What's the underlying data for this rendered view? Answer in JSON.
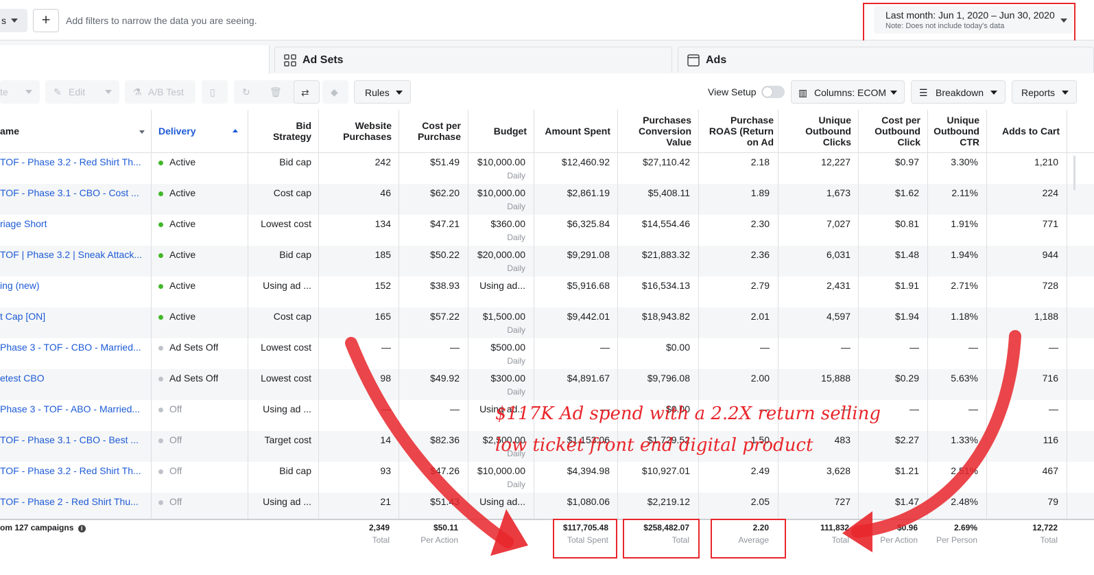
{
  "topbar": {
    "seg_label": "s",
    "plus": "+",
    "filter_placeholder": "Add filters to narrow the data you are seeing.",
    "date_range": "Last month: Jun 1, 2020 – Jun 30, 2020",
    "date_note": "Note: Does not include today's data"
  },
  "tabs": [
    {
      "label": "Ad Sets",
      "icon": "ad-sets-grid-icon"
    },
    {
      "label": "Ads",
      "icon": "ads-window-icon"
    }
  ],
  "toolbar": {
    "duplicate_fragment": "te",
    "edit": "Edit",
    "ab_test": "A/B Test",
    "rules": "Rules",
    "view_setup": "View Setup",
    "columns": "Columns: ECOM",
    "breakdown": "Breakdown",
    "reports": "Reports"
  },
  "columns": {
    "name": "ame",
    "delivery": "Delivery",
    "bid_strategy": "Bid Strategy",
    "website_purchases": "Website Purchases",
    "cost_per_purchase": "Cost per Purchase",
    "budget": "Budget",
    "amount_spent": "Amount Spent",
    "conv_value": "Purchases Conversion Value",
    "roas": "Purchase ROAS (Return on Ad",
    "unique_clicks": "Unique Outbound Clicks",
    "cost_per_click": "Cost per Outbound Click",
    "unique_ctr": "Unique Outbound CTR",
    "adds_to_cart": "Adds to Cart"
  },
  "rows": [
    {
      "name": "TOF - Phase 3.2 - Red Shirt Th...",
      "delivery": "Active",
      "status": "active",
      "bid": "Bid cap",
      "wp": "242",
      "cpp": "$51.49",
      "budget": "$10,000.00",
      "budget_sub": "Daily",
      "spent": "$12,460.92",
      "value": "$27,110.42",
      "roas": "2.18",
      "clicks": "12,227",
      "cpc": "$0.97",
      "ctr": "3.30%",
      "atc": "1,210"
    },
    {
      "name": "TOF - Phase 3.1 - CBO - Cost ...",
      "delivery": "Active",
      "status": "active",
      "bid": "Cost cap",
      "wp": "46",
      "cpp": "$62.20",
      "budget": "$10,000.00",
      "budget_sub": "Daily",
      "spent": "$2,861.19",
      "value": "$5,408.11",
      "roas": "1.89",
      "clicks": "1,673",
      "cpc": "$1.62",
      "ctr": "2.11%",
      "atc": "224"
    },
    {
      "name": "riage Short",
      "delivery": "Active",
      "status": "active",
      "bid": "Lowest cost",
      "wp": "134",
      "cpp": "$47.21",
      "budget": "$360.00",
      "budget_sub": "Daily",
      "spent": "$6,325.84",
      "value": "$14,554.46",
      "roas": "2.30",
      "clicks": "7,027",
      "cpc": "$0.81",
      "ctr": "1.91%",
      "atc": "771"
    },
    {
      "name": "TOF | Phase 3.2 | Sneak Attack...",
      "delivery": "Active",
      "status": "active",
      "bid": "Bid cap",
      "wp": "185",
      "cpp": "$50.22",
      "budget": "$20,000.00",
      "budget_sub": "Daily",
      "spent": "$9,291.08",
      "value": "$21,883.32",
      "roas": "2.36",
      "clicks": "6,031",
      "cpc": "$1.48",
      "ctr": "1.94%",
      "atc": "944"
    },
    {
      "name": "ing (new)",
      "delivery": "Active",
      "status": "active",
      "bid": "Using ad ...",
      "wp": "152",
      "cpp": "$38.93",
      "budget": "Using ad...",
      "budget_sub": "",
      "spent": "$5,916.68",
      "value": "$16,534.13",
      "roas": "2.79",
      "clicks": "2,431",
      "cpc": "$1.91",
      "ctr": "2.71%",
      "atc": "728"
    },
    {
      "name": "t Cap [ON]",
      "delivery": "Active",
      "status": "active",
      "bid": "Cost cap",
      "wp": "165",
      "cpp": "$57.22",
      "budget": "$1,500.00",
      "budget_sub": "Daily",
      "spent": "$9,442.01",
      "value": "$18,943.82",
      "roas": "2.01",
      "clicks": "4,597",
      "cpc": "$1.94",
      "ctr": "1.18%",
      "atc": "1,188"
    },
    {
      "name": "Phase 3 - TOF - CBO - Married...",
      "delivery": "Ad Sets Off",
      "status": "adsetsoff",
      "bid": "Lowest cost",
      "wp": "—",
      "cpp": "—",
      "budget": "$500.00",
      "budget_sub": "Daily",
      "spent": "—",
      "value": "$0.00",
      "roas": "—",
      "clicks": "—",
      "cpc": "—",
      "ctr": "—",
      "atc": "—"
    },
    {
      "name": "etest CBO",
      "delivery": "Ad Sets Off",
      "status": "adsetsoff",
      "bid": "Lowest cost",
      "wp": "98",
      "cpp": "$49.92",
      "budget": "$300.00",
      "budget_sub": "Daily",
      "spent": "$4,891.67",
      "value": "$9,796.08",
      "roas": "2.00",
      "clicks": "15,888",
      "cpc": "$0.29",
      "ctr": "5.63%",
      "atc": "716"
    },
    {
      "name": "Phase 3 - TOF - ABO - Married...",
      "delivery": "Off",
      "status": "off",
      "bid": "Using ad ...",
      "wp": "—",
      "cpp": "—",
      "budget": "Using ad...",
      "budget_sub": "",
      "spent": "—",
      "value": "$0.00",
      "roas": "—",
      "clicks": "—",
      "cpc": "—",
      "ctr": "—",
      "atc": "—"
    },
    {
      "name": "TOF - Phase 3.1 - CBO - Best ...",
      "delivery": "Off",
      "status": "off",
      "bid": "Target cost",
      "wp": "14",
      "cpp": "$82.36",
      "budget": "$2,500.00",
      "budget_sub": "Daily",
      "spent": "$1,153.06",
      "value": "$1,729.52",
      "roas": "1.50",
      "clicks": "483",
      "cpc": "$2.27",
      "ctr": "1.33%",
      "atc": "116"
    },
    {
      "name": "TOF - Phase 3.2 - Red Shirt Th...",
      "delivery": "Off",
      "status": "off",
      "bid": "Bid cap",
      "wp": "93",
      "cpp": "$47.26",
      "budget": "$10,000.00",
      "budget_sub": "Daily",
      "spent": "$4,394.98",
      "value": "$10,927.01",
      "roas": "2.49",
      "clicks": "3,628",
      "cpc": "$1.21",
      "ctr": "2.51%",
      "atc": "467"
    },
    {
      "name": "TOF - Phase 2 - Red Shirt Thu...",
      "delivery": "Off",
      "status": "off",
      "bid": "Using ad ...",
      "wp": "21",
      "cpp": "$51.43",
      "budget": "Using ad...",
      "budget_sub": "",
      "spent": "$1,080.06",
      "value": "$2,219.12",
      "roas": "2.05",
      "clicks": "727",
      "cpc": "$1.47",
      "ctr": "2.48%",
      "atc": "79"
    }
  ],
  "footer": {
    "label": "om 127 campaigns",
    "wp": "2,349",
    "wp_sub": "Total",
    "cpp": "$50.11",
    "cpp_sub": "Per Action",
    "spent": "$117,705.48",
    "spent_sub": "Total Spent",
    "value": "$258,482.07",
    "value_sub": "Total",
    "roas": "2.20",
    "roas_sub": "Average",
    "clicks": "111,832",
    "clicks_sub": "Total",
    "cpc": "$0.96",
    "cpc_sub": "Per Action",
    "ctr": "2.69%",
    "ctr_sub": "Per Person",
    "atc": "12,722",
    "atc_sub": "Total"
  },
  "annotation": {
    "line1": "$117K Ad spend with a 2.2X return selling",
    "line2": "low ticket front end digital product"
  },
  "colors": {
    "accent": "#1d5bd6",
    "active": "#42b72a",
    "off": "#bec3c9",
    "annotation": "#e8262b"
  }
}
